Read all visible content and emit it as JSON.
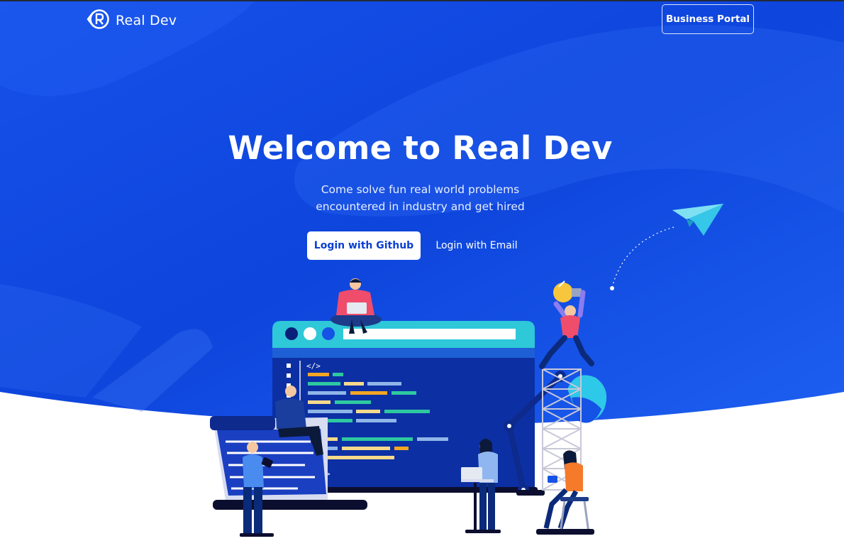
{
  "brand": {
    "name": "Real Dev",
    "logo_icon": "real-dev-logo-icon"
  },
  "header": {
    "portal_label": "Business Portal"
  },
  "hero": {
    "title": "Welcome to Real Dev",
    "subtitle_line1": "Come solve fun real world problems",
    "subtitle_line2": "encountered in industry and get hired",
    "github_label": "Login with Github",
    "email_label": "Login with Email"
  },
  "colors": {
    "hero_gradient_start": "#0a3fd6",
    "hero_gradient_end": "#1f62ef",
    "button_text": "#0a3fd1",
    "accent_teal": "#2ec8d8",
    "accent_orange": "#f5a623"
  },
  "illustration": {
    "name": "developers-working-illustration",
    "icons": [
      "paper-plane-icon",
      "light-bulb-icon",
      "code-window-icon"
    ]
  }
}
